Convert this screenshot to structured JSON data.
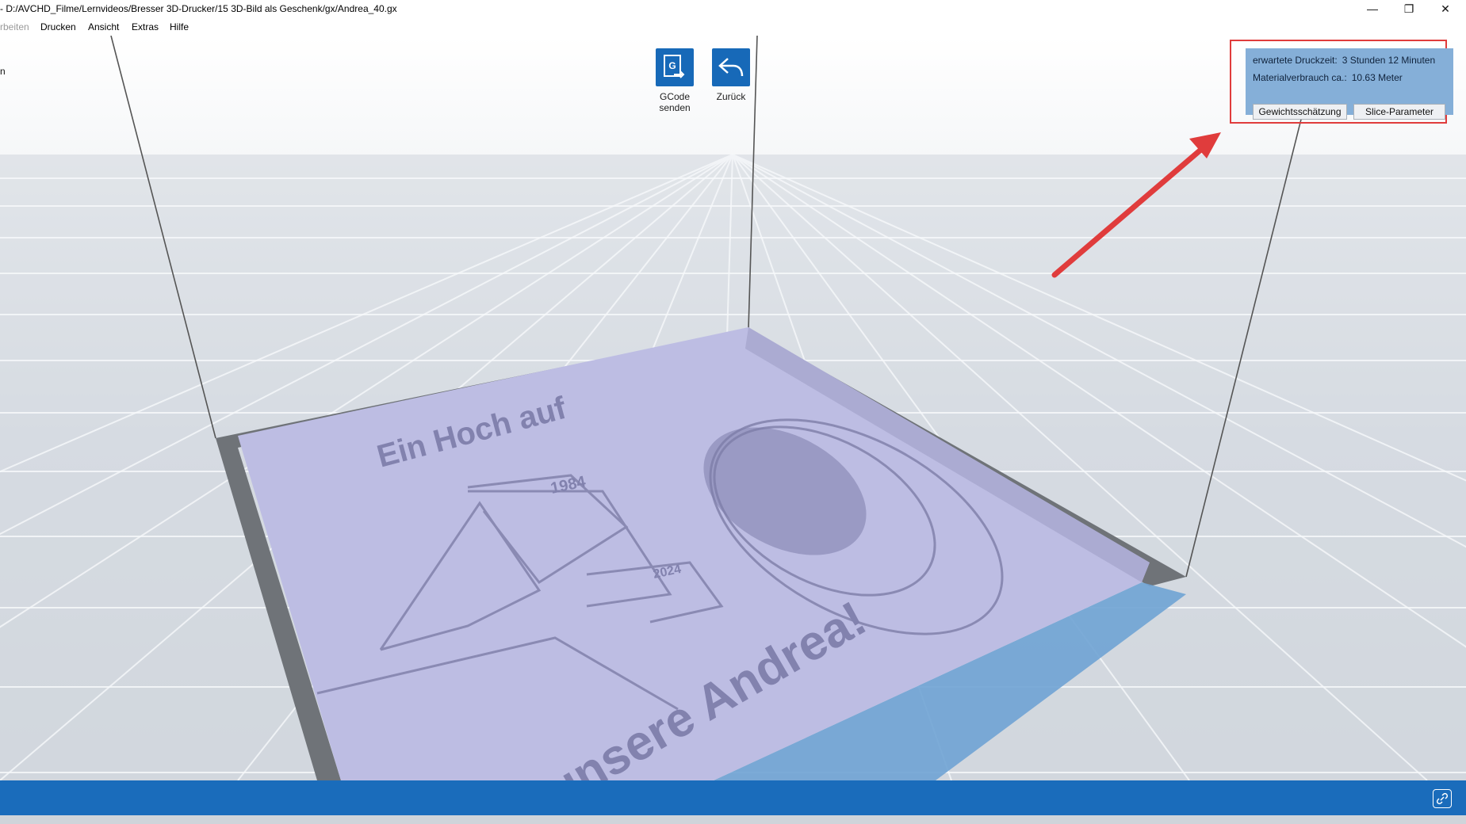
{
  "window": {
    "title": "- D:/AVCHD_Filme/Lernvideos/Bresser 3D-Drucker/15 3D-Bild als Geschenk/gx/Andrea_40.gx",
    "minimize_glyph": "—",
    "restore_glyph": "❐",
    "close_glyph": "✕"
  },
  "menu": {
    "items": [
      "rbeiten",
      "Drucken",
      "Ansicht",
      "Extras",
      "Hilfe"
    ]
  },
  "toolbar": {
    "gcode_line1": "GCode",
    "gcode_line2": "senden",
    "gcode_icon_letter": "G",
    "back_label": "Zurück"
  },
  "info": {
    "print_time_label": "erwartete Druckzeit:",
    "print_time_value": "3 Stunden 12 Minuten",
    "material_label": "Materialverbrauch ca.:",
    "material_value": "10.63 Meter",
    "weight_button": "Gewichtsschätzung",
    "slice_button": "Slice-Parameter"
  },
  "model": {
    "line1": "Ein Hoch auf",
    "line2": "unsere Andrea!",
    "number": "40",
    "year_start": "1984",
    "year_end": "2024"
  },
  "left_cut": {
    "top_char": "n"
  },
  "colors": {
    "accent": "#1a6cbb",
    "panel": "#85afd8",
    "highlight": "#e03c3c",
    "model": "#bdbde3"
  },
  "icons": [
    "gcode-send-icon",
    "undo-arrow-icon",
    "link-icon"
  ]
}
